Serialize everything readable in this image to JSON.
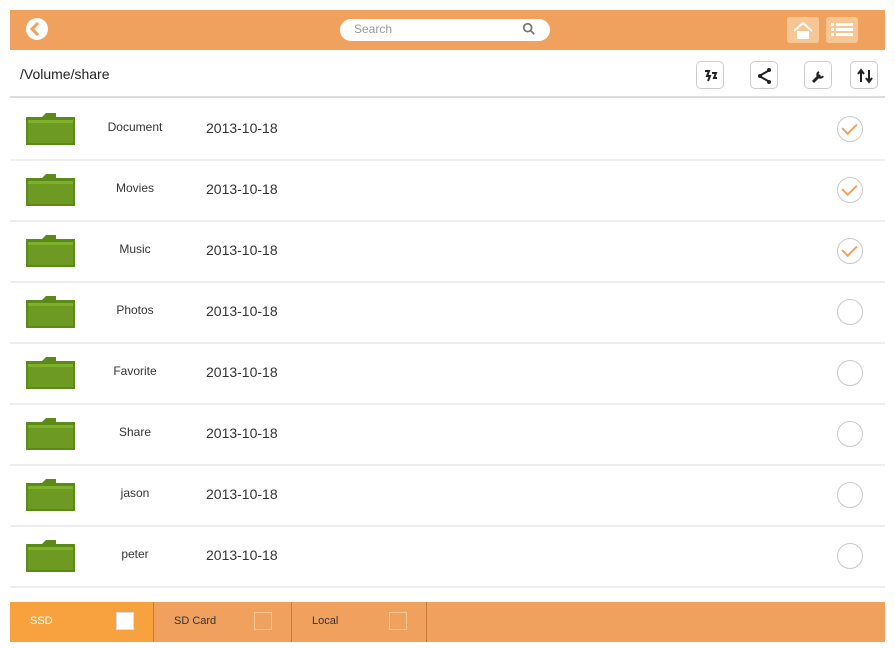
{
  "header": {
    "search_placeholder": "Search"
  },
  "toolbar": {
    "path": "/Volume/share"
  },
  "files": [
    {
      "name": "Document",
      "date": "2013-10-18",
      "checked": true
    },
    {
      "name": "Movies",
      "date": "2013-10-18",
      "checked": true
    },
    {
      "name": "Music",
      "date": "2013-10-18",
      "checked": true
    },
    {
      "name": "Photos",
      "date": "2013-10-18",
      "checked": false
    },
    {
      "name": "Favorite",
      "date": "2013-10-18",
      "checked": false
    },
    {
      "name": "Share",
      "date": "2013-10-18",
      "checked": false
    },
    {
      "name": "jason",
      "date": "2013-10-18",
      "checked": false
    },
    {
      "name": "peter",
      "date": "2013-10-18",
      "checked": false
    }
  ],
  "bottom_tabs": [
    {
      "label": "SSD",
      "active": true
    },
    {
      "label": "SD Card",
      "active": false
    },
    {
      "label": "Local",
      "active": false
    }
  ],
  "colors": {
    "accent": "#f1a15e",
    "folder": "#6c9a22"
  },
  "icons": {
    "back": "back-icon",
    "search": "search-icon",
    "home": "home-icon",
    "menu": "menu-icon",
    "folder": "folder-icon",
    "refresh": "refresh-icon",
    "share": "share-icon",
    "tools": "wrench-icon",
    "sort": "sort-icon"
  }
}
